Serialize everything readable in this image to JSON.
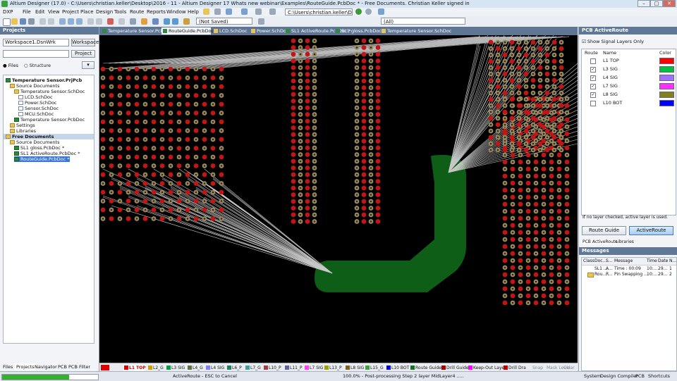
{
  "app": {
    "title": "Altium Designer (17.0) - C:\\Users\\christian.keller\\Desktop\\2016 - 11 - Altium Designer 17 Whats new webinar\\Examples\\RouteGuide.PcbDoc * - Free Documents. Christian Keller signed in",
    "window_buttons": [
      "–",
      "□",
      "✕"
    ]
  },
  "menu": [
    "DXP",
    "File",
    "Edit",
    "View",
    "Project",
    "Place",
    "Design",
    "Tools",
    "Route",
    "Reports",
    "Window",
    "Help"
  ],
  "toolbar": {
    "path": "C:\\Users\\christian.keller\\Desktop\\2 ▾",
    "variant": "(Not Saved)",
    "filter": "(All)"
  },
  "projects_panel": {
    "title": "Projects",
    "workspace": "Workspace1.DsnWrk",
    "workspace_button": "Workspace",
    "project_button": "Project",
    "view_files": "Files",
    "view_structure": "Structure",
    "tree": [
      {
        "label": "Temperature Sensor.PrjPcb",
        "level": 0,
        "icon": "project-icon",
        "bold": true
      },
      {
        "label": "Source Documents",
        "level": 1,
        "icon": "folder-icon"
      },
      {
        "label": "Temperature Sensor.SchDoc",
        "level": 2,
        "icon": "folder-icon"
      },
      {
        "label": "LCD.SchDoc",
        "level": 3,
        "icon": "doc-icon"
      },
      {
        "label": "Power.SchDoc",
        "level": 3,
        "icon": "doc-icon"
      },
      {
        "label": "Sensor.SchDoc",
        "level": 3,
        "icon": "doc-icon"
      },
      {
        "label": "MCU.SchDoc",
        "level": 3,
        "icon": "doc-icon"
      },
      {
        "label": "Temperature Sensor.PcbDoc",
        "level": 2,
        "icon": "pcb-icon"
      },
      {
        "label": "Settings",
        "level": 1,
        "icon": "folder-icon"
      },
      {
        "label": "Libraries",
        "level": 1,
        "icon": "folder-icon"
      },
      {
        "label": "Free Documents",
        "level": 0,
        "icon": "folder-icon",
        "bold": true,
        "highlight": true
      },
      {
        "label": "Source Documents",
        "level": 1,
        "icon": "folder-icon"
      },
      {
        "label": "SL1 gloss.PcbDoc *",
        "level": 2,
        "icon": "pcb-icon"
      },
      {
        "label": "SL1 ActiveRoute.PcbDoc *",
        "level": 2,
        "icon": "pcb-icon"
      },
      {
        "label": "RouteGuide.PcbDoc *",
        "level": 2,
        "icon": "pcb-icon",
        "selected": true
      }
    ],
    "bottom_tabs": [
      "Files",
      "Projects",
      "Navigator",
      "PCB",
      "PCB Filter"
    ]
  },
  "doc_tabs": [
    {
      "label": "Temperature Sensor.PcbDoc",
      "color": "#2d8a3e"
    },
    {
      "label": "RouteGuide.PcbDoc *",
      "color": "#2d8a3e",
      "active": true
    },
    {
      "label": "LCD.SchDoc",
      "color": "#e8c45a"
    },
    {
      "label": "Power.SchDoc",
      "color": "#e8c45a"
    },
    {
      "label": "SL1 ActiveRoute.PcbDoc *",
      "color": "#2d8a3e"
    },
    {
      "label": "SL1 gloss.PcbDoc *",
      "color": "#2d8a3e"
    },
    {
      "label": "Temperature Sensor.SchDoc",
      "color": "#e8c45a"
    }
  ],
  "layer_tabs": [
    {
      "label": "L1 TOP",
      "color": "#e00000",
      "active": true
    },
    {
      "label": "L2_G",
      "color": "#d0a000"
    },
    {
      "label": "L3 SIG",
      "color": "#00a040"
    },
    {
      "label": "L4_G",
      "color": "#607040"
    },
    {
      "label": "L4 SIG",
      "color": "#8080ff"
    },
    {
      "label": "L6_P",
      "color": "#208060"
    },
    {
      "label": "L7_G",
      "color": "#40a0a0"
    },
    {
      "label": "L10_P",
      "color": "#a04040"
    },
    {
      "label": "L11_P",
      "color": "#6060a0"
    },
    {
      "label": "L7 SIG",
      "color": "#ff40ff"
    },
    {
      "label": "L13_P",
      "color": "#a0a000"
    },
    {
      "label": "L8 SIG",
      "color": "#806020"
    },
    {
      "label": "L15_G",
      "color": "#40a040"
    },
    {
      "label": "L10 BOT",
      "color": "#0000e0"
    },
    {
      "label": "Route Guide",
      "color": "#1a6a2a"
    },
    {
      "label": "Drill Guide",
      "color": "#a00000"
    },
    {
      "label": "Keep-Out Layer",
      "color": "#ff00ff"
    },
    {
      "label": "Drill Dra",
      "color": "#c00000"
    }
  ],
  "layer_bar_extras": [
    "Snap",
    "Mask Level",
    "Clear"
  ],
  "activeroute_panel": {
    "title": "PCB ActiveRoute",
    "show_signal_label": "Show Signal Layers Only",
    "show_signal_checked": true,
    "columns": [
      "Route",
      "Name",
      "Color"
    ],
    "layers": [
      {
        "name": "L1 TOP",
        "checked": false,
        "color": "#ff0000"
      },
      {
        "name": "L3 SIG",
        "checked": true,
        "color": "#00c040"
      },
      {
        "name": "L4 SIG",
        "checked": true,
        "color": "#a070ff"
      },
      {
        "name": "L7 SIG",
        "checked": true,
        "color": "#ff30ff"
      },
      {
        "name": "L8 SIG",
        "checked": true,
        "color": "#808020"
      },
      {
        "name": "L10 BOT",
        "checked": false,
        "color": "#0000ff"
      }
    ],
    "hint": "If no layer checked, active layer is used.",
    "route_guide_button": "Route Guide",
    "activeroute_button": "ActiveRoute",
    "tabs": [
      "PCB ActiveRoute",
      "Libraries"
    ]
  },
  "messages_panel": {
    "title": "Messages",
    "columns": [
      "Class",
      "Doc...",
      "S...",
      "Message",
      "Time",
      "Date",
      "N..."
    ],
    "rows": [
      {
        "class": "",
        "doc": "SL1 ...",
        "source": "A...",
        "message": "Time : 00:09",
        "time": "10:...",
        "date": "29...",
        "n": "1"
      },
      {
        "class": "",
        "doc": "Rou...",
        "source": "R...",
        "message": "Pin Swapping ...",
        "time": "10:...",
        "date": "29...",
        "n": "2"
      }
    ]
  },
  "statusbar": {
    "hint": "ActiveRoute - ESC to Cancel",
    "progress_text": "100.0% - Post-processing Step 2 layer MidLayer4 .....",
    "progress": 0.7,
    "right_items": [
      "System",
      "Design Compiler",
      "PCB",
      "Shortcuts"
    ]
  }
}
